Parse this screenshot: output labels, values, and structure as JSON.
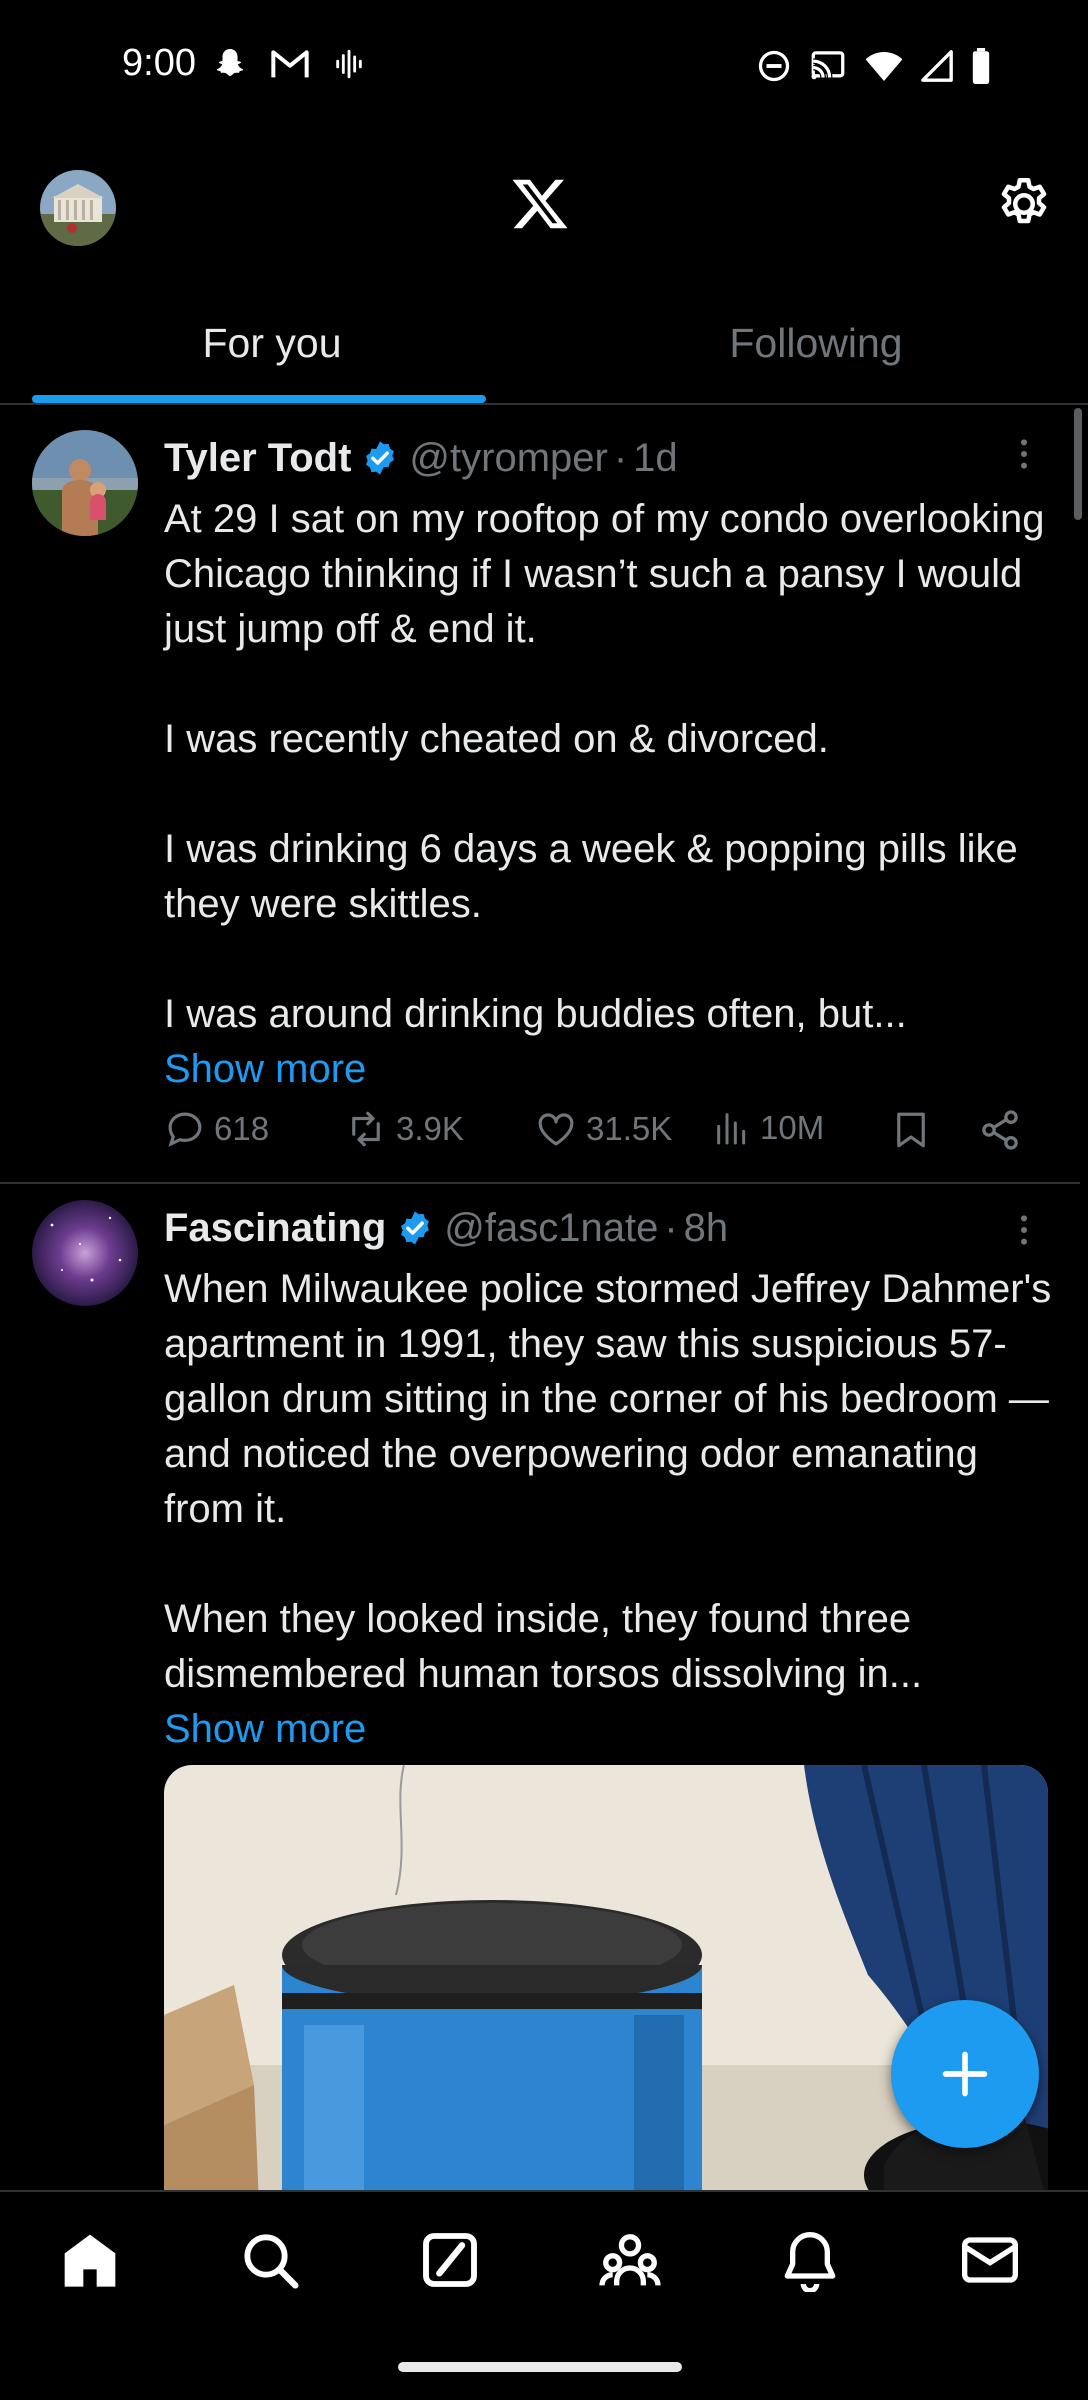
{
  "status_bar": {
    "time": "9:00",
    "left_icons": [
      "snapchat-icon",
      "gmail-icon",
      "voicemail-icon"
    ],
    "right_icons": [
      "dnd-icon",
      "cast-icon",
      "wifi-icon",
      "signal-icon",
      "battery-icon"
    ]
  },
  "header": {
    "logo": "X",
    "left_icon": "profile-avatar",
    "right_icon": "settings-gear-icon"
  },
  "tabs": [
    {
      "label": "For you",
      "active": true
    },
    {
      "label": "Following",
      "active": false
    }
  ],
  "tweets": [
    {
      "name": "Tyler Todt",
      "handle": "@tyromper",
      "separator": "·",
      "age": "1d",
      "verified": true,
      "paragraphs": [
        "At 29 I sat on my rooftop of my condo overlooking Chicago thinking if I wasn’t such a pansy I would just jump off & end it.",
        "I was recently cheated on & divorced.",
        "I was drinking 6 days a week & popping pills like they were skittles.",
        "I was around drinking buddies often, but..."
      ],
      "show_more": "Show more",
      "replies": "618",
      "reposts": "3.9K",
      "likes": "31.5K",
      "views": "10M"
    },
    {
      "name": "Fascinating",
      "handle": "@fasc1nate",
      "separator": "·",
      "age": "8h",
      "verified": true,
      "paragraphs": [
        "When Milwaukee police stormed Jeffrey Dahmer's apartment in 1991, they saw this suspicious 57-gallon drum sitting in the corner of his bedroom — and noticed the overpowering odor emanating from it.",
        "When they looked inside, they found three dismembered human torsos dissolving in..."
      ],
      "show_more": "Show more",
      "media_alt": "photo of blue barrel"
    }
  ],
  "bottom_nav": [
    "home-icon",
    "search-icon",
    "grok-icon",
    "communities-icon",
    "notifications-icon",
    "messages-icon"
  ],
  "colors": {
    "accent": "#1d9bf0",
    "background": "#000000",
    "text": "#e7e9ea",
    "muted": "#71767b",
    "divider": "#2f3336"
  }
}
